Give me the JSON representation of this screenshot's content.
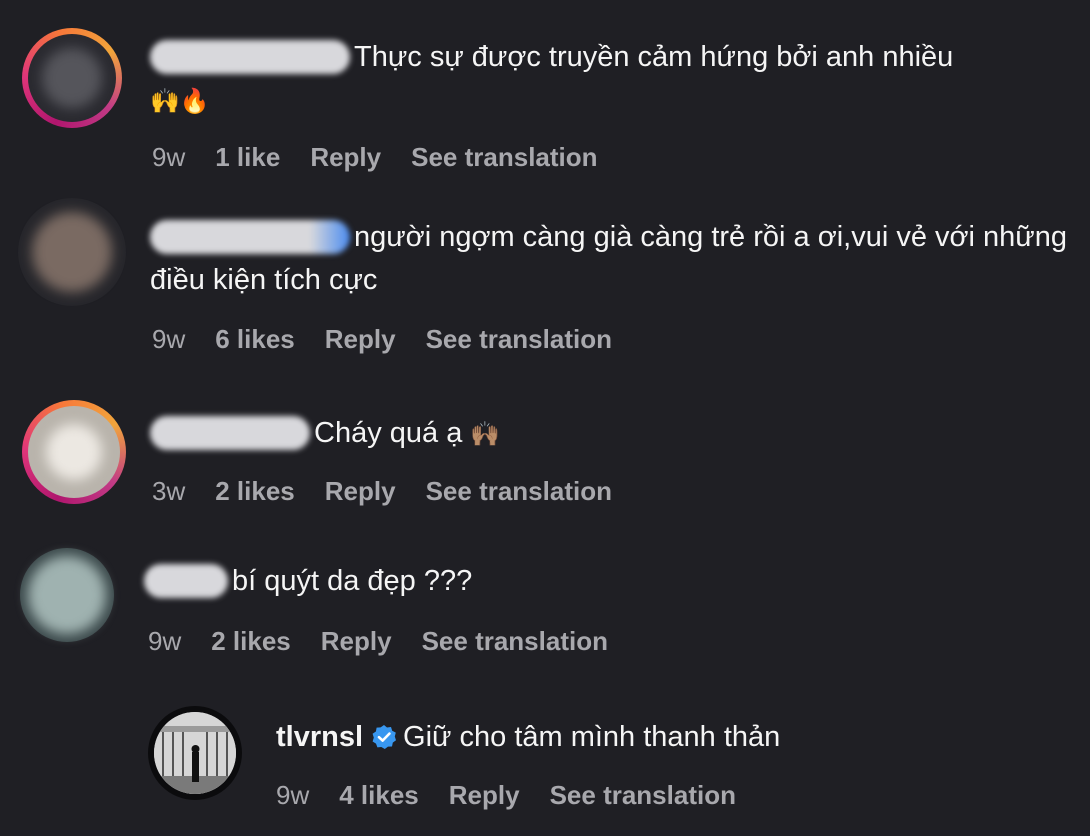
{
  "comments": [
    {
      "text": "Thực sự được truyền cảm hứng bởi anh nhiều",
      "emoji": "🙌🔥",
      "time": "9w",
      "likes": "1 like",
      "reply": "Reply",
      "translate": "See translation"
    },
    {
      "text": "người ngợm càng già càng trẻ rồi a ơi,vui vẻ với những điều kiện tích cực",
      "time": "9w",
      "likes": "6 likes",
      "reply": "Reply",
      "translate": "See translation"
    },
    {
      "text": "Cháy quá ạ",
      "emoji": "🙌🏽",
      "time": "3w",
      "likes": "2 likes",
      "reply": "Reply",
      "translate": "See translation"
    },
    {
      "text": "bí quýt da đẹp ???",
      "time": "9w",
      "likes": "2 likes",
      "reply": "Reply",
      "translate": "See translation"
    }
  ],
  "reply": {
    "username": "tlvrnsl",
    "text": "Giữ cho tâm mình thanh thản",
    "time": "9w",
    "likes": "4 likes",
    "reply": "Reply",
    "translate": "See translation"
  },
  "colors": {
    "background": "#1f1f24",
    "text": "#f5f5f5",
    "meta": "#a8a8ad",
    "verified": "#3897f0"
  }
}
